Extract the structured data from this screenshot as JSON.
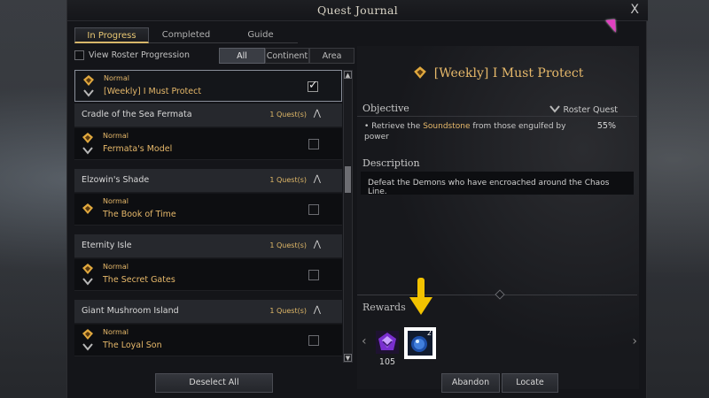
{
  "window": {
    "title": "Quest Journal",
    "close_label": "X"
  },
  "tabs": [
    {
      "label": "In Progress",
      "active": true
    },
    {
      "label": "Completed",
      "active": false
    },
    {
      "label": "Guide",
      "active": false
    }
  ],
  "filter": {
    "roster_label": "View Roster Progression",
    "segments": [
      {
        "label": "All",
        "active": true
      },
      {
        "label": "Continent",
        "active": false
      },
      {
        "label": "Area",
        "active": false
      }
    ]
  },
  "list": {
    "selected_quest": {
      "difficulty": "Normal",
      "name": "[Weekly] I Must Protect",
      "checked": true
    },
    "groups": [
      {
        "name": "Cradle of the Sea Fermata",
        "count": "1 Quest(s)",
        "quest": {
          "difficulty": "Normal",
          "name": "Fermata's Model",
          "checked": false
        }
      },
      {
        "name": "Elzowin's Shade",
        "count": "1 Quest(s)",
        "quest": {
          "difficulty": "Normal",
          "name": "The Book of Time",
          "checked": false
        }
      },
      {
        "name": "Eternity Isle",
        "count": "1 Quest(s)",
        "quest": {
          "difficulty": "Normal",
          "name": "The Secret Gates",
          "checked": false
        }
      },
      {
        "name": "Giant Mushroom Island",
        "count": "1 Quest(s)",
        "quest": {
          "difficulty": "Normal",
          "name": "The Loyal Son",
          "checked": false
        }
      }
    ]
  },
  "buttons": {
    "deselect_all": "Deselect All",
    "abandon": "Abandon",
    "locate": "Locate"
  },
  "detail": {
    "title": "[Weekly] I Must Protect",
    "objective_heading": "Objective",
    "roster_quest_label": "Roster Quest",
    "objective_prefix": "Retrieve the ",
    "objective_highlight": "Soundstone",
    "objective_suffix": " from those engulfed by power",
    "objective_progress": "55%",
    "description_heading": "Description",
    "description_text": "Defeat the Demons who have encroached around the Chaos Line.",
    "rewards_heading": "Rewards",
    "reward_items": [
      {
        "icon": "purple-crystal-icon",
        "count": "105"
      },
      {
        "icon": "blue-orb-icon",
        "count": "2"
      }
    ]
  },
  "colors": {
    "accent_gold": "#e6b86a",
    "highlight_arrow": "#f2c200",
    "cursor": "#e040c0"
  }
}
